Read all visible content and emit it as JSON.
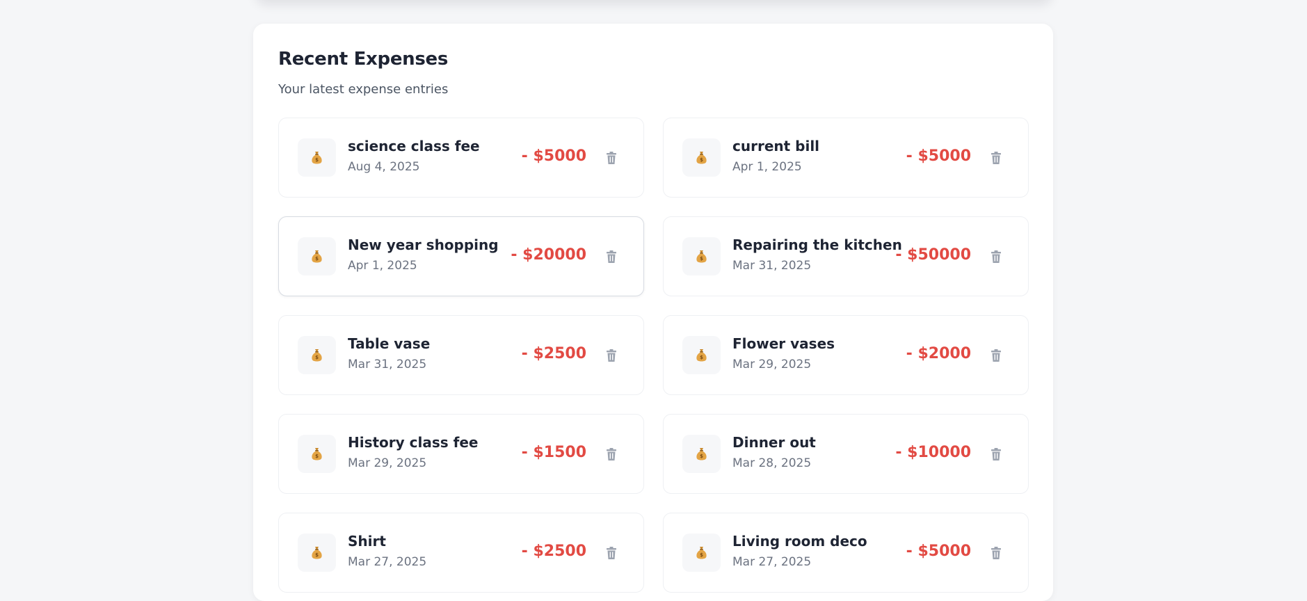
{
  "panel": {
    "title": "Recent Expenses",
    "subtitle": "Your latest expense entries"
  },
  "icons": {
    "entry": "money-bag-icon",
    "delete": "trash-icon"
  },
  "colors": {
    "amount": "#e24a43",
    "title": "#1e2433",
    "muted": "#6b7280"
  },
  "expenses": [
    {
      "name": "science class fee",
      "date": "Aug 4, 2025",
      "amount": "- $5000"
    },
    {
      "name": "current bill",
      "date": "Apr 1, 2025",
      "amount": "- $5000"
    },
    {
      "name": "New year shopping",
      "date": "Apr 1, 2025",
      "amount": "- $20000"
    },
    {
      "name": "Repairing the kitchen",
      "date": "Mar 31, 2025",
      "amount": "- $50000"
    },
    {
      "name": "Table vase",
      "date": "Mar 31, 2025",
      "amount": "- $2500"
    },
    {
      "name": "Flower vases",
      "date": "Mar 29, 2025",
      "amount": "- $2000"
    },
    {
      "name": "History class fee",
      "date": "Mar 29, 2025",
      "amount": "- $1500"
    },
    {
      "name": "Dinner out",
      "date": "Mar 28, 2025",
      "amount": "- $10000"
    },
    {
      "name": "Shirt",
      "date": "Mar 27, 2025",
      "amount": "- $2500"
    },
    {
      "name": "Living room deco",
      "date": "Mar 27, 2025",
      "amount": "- $5000"
    }
  ]
}
